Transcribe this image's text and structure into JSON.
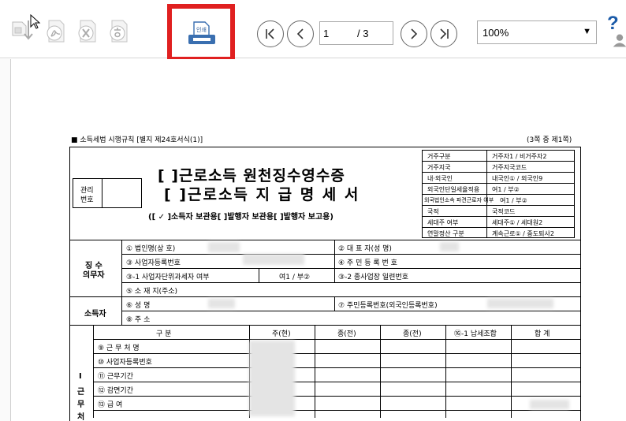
{
  "toolbar": {
    "print_label": "인쇄",
    "page_current": "1",
    "page_total": "/ 3",
    "zoom": "100%",
    "zoom_arrow": "▼",
    "help": "?"
  },
  "doc": {
    "header_left": "■ 소득세법 시행규칙 [별지 제24호서식(1)]",
    "header_right": "(3쪽 중 제1쪽)",
    "mgmt_label_1": "관리",
    "mgmt_label_2": "번호",
    "title_1": "[ ]근로소득 원천징수영수증",
    "title_2": "[ ]근로소득 지 급 명 세 서",
    "purpose": "([ ✓ ]소득자 보관용[    ]발행자 보관용[    ]발행자 보고용)",
    "side": [
      [
        "거주구분",
        "거주자1 / 비거주자2"
      ],
      [
        "거주지국",
        "거주지국코드"
      ],
      [
        "내·외국인",
        "내국인① / 외국인9"
      ],
      [
        "외국인단일세율적용",
        "여1 / 부②"
      ],
      [
        "외국법인소속 파견근로자 여부",
        "여1 / 부②"
      ],
      [
        "국적",
        "국적코드"
      ],
      [
        "세대주 여부",
        "세대주① / 세대원2"
      ],
      [
        "연말정산 구분",
        "계속근로① / 중도퇴사2"
      ]
    ],
    "payer_label_1": "징 수",
    "payer_label_2": "의무자",
    "payer_rows": {
      "r1_left": "① 법인명(상 호)",
      "r1_right": "② 대 표 자(성  명)",
      "r2_left": "③ 사업자등록번호",
      "r2_right": "④ 주 민 등 록 번 호",
      "r3_left": "③-1 사업자단위과세자 여부",
      "r3_mid": "여1 / 부②",
      "r3_right": "③-2 종사업장 일련번호",
      "r4": "⑤ 소 재 지(주소)"
    },
    "earner_label": "소득자",
    "earner_rows": {
      "r1_left": "⑥ 성     명",
      "r1_right": "⑦ 주민등록번호(외국인등록번호)",
      "r2_left": "⑧ 주     소"
    },
    "work_header": [
      "구   분",
      "주(현)",
      "종(전)",
      "종(전)",
      "⑯-1 납세조합",
      "합   계"
    ],
    "work_side": [
      "Ⅰ",
      "근",
      "무",
      "처"
    ],
    "work_rows": [
      "⑨ 근 무 처 명",
      "⑩ 사업자등록번호",
      "⑪ 근무기간",
      "⑫ 감면기간",
      "⑬ 급        여"
    ]
  }
}
